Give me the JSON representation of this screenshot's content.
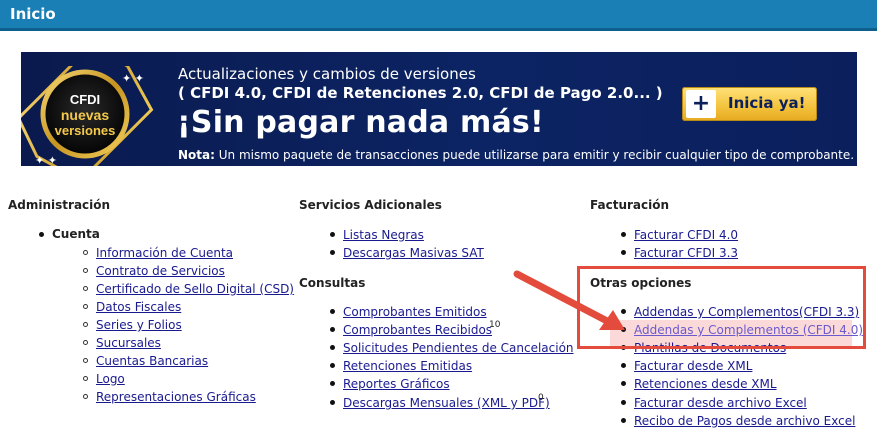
{
  "page": {
    "title": "Inicio"
  },
  "banner": {
    "badge_lines": [
      "CFDI",
      "nuevas",
      "versiones"
    ],
    "line1": "Actualizaciones y cambios de versiones",
    "line2": "( CFDI 4.0, CFDI de Retenciones 2.0, CFDI de Pago 2.0... )",
    "headline": "¡Sin pagar nada más!",
    "note_label": "Nota:",
    "note_text": " Un mismo paquete de transacciones puede utilizarse para emitir y recibir cualquier tipo de comprobante.",
    "cta_plus": "+",
    "cta_label": "Inicia ya!"
  },
  "administracion": {
    "title": "Administración",
    "group": "Cuenta",
    "items": [
      "Información de Cuenta",
      "Contrato de Servicios",
      "Certificado de Sello Digital (CSD)",
      "Datos Fiscales",
      "Series y Folios",
      "Sucursales",
      "Cuentas Bancarias",
      "Logo",
      "Representaciones Gráficas"
    ]
  },
  "servicios": {
    "title": "Servicios Adicionales",
    "items": [
      "Listas Negras",
      "Descargas Masivas SAT"
    ]
  },
  "consultas": {
    "title": "Consultas",
    "items": [
      "Comprobantes Emitidos",
      "Comprobantes Recibidos",
      "Solicitudes Pendientes de Cancelación",
      "Retenciones Emitidas",
      "Reportes Gráficos",
      "Descargas Mensuales (XML y PDF)"
    ],
    "recibidos_count": "10",
    "descargas_count": "0"
  },
  "facturacion": {
    "title": "Facturación",
    "items": [
      "Facturar CFDI 4.0",
      "Facturar CFDI 3.3"
    ]
  },
  "otras": {
    "title": "Otras opciones",
    "items": [
      "Addendas y Complementos(CFDI 3.3)",
      "Addendas y Complementos (CFDI 4.0)",
      "Plantillas de Documentos",
      "Facturar desde XML",
      "Retenciones desde XML",
      "Facturar desde archivo Excel",
      "Recibo de Pagos desde archivo Excel"
    ]
  },
  "colors": {
    "header": "#1a7fb5",
    "link": "#1a1a8f",
    "annotation": "#e34b3d"
  }
}
